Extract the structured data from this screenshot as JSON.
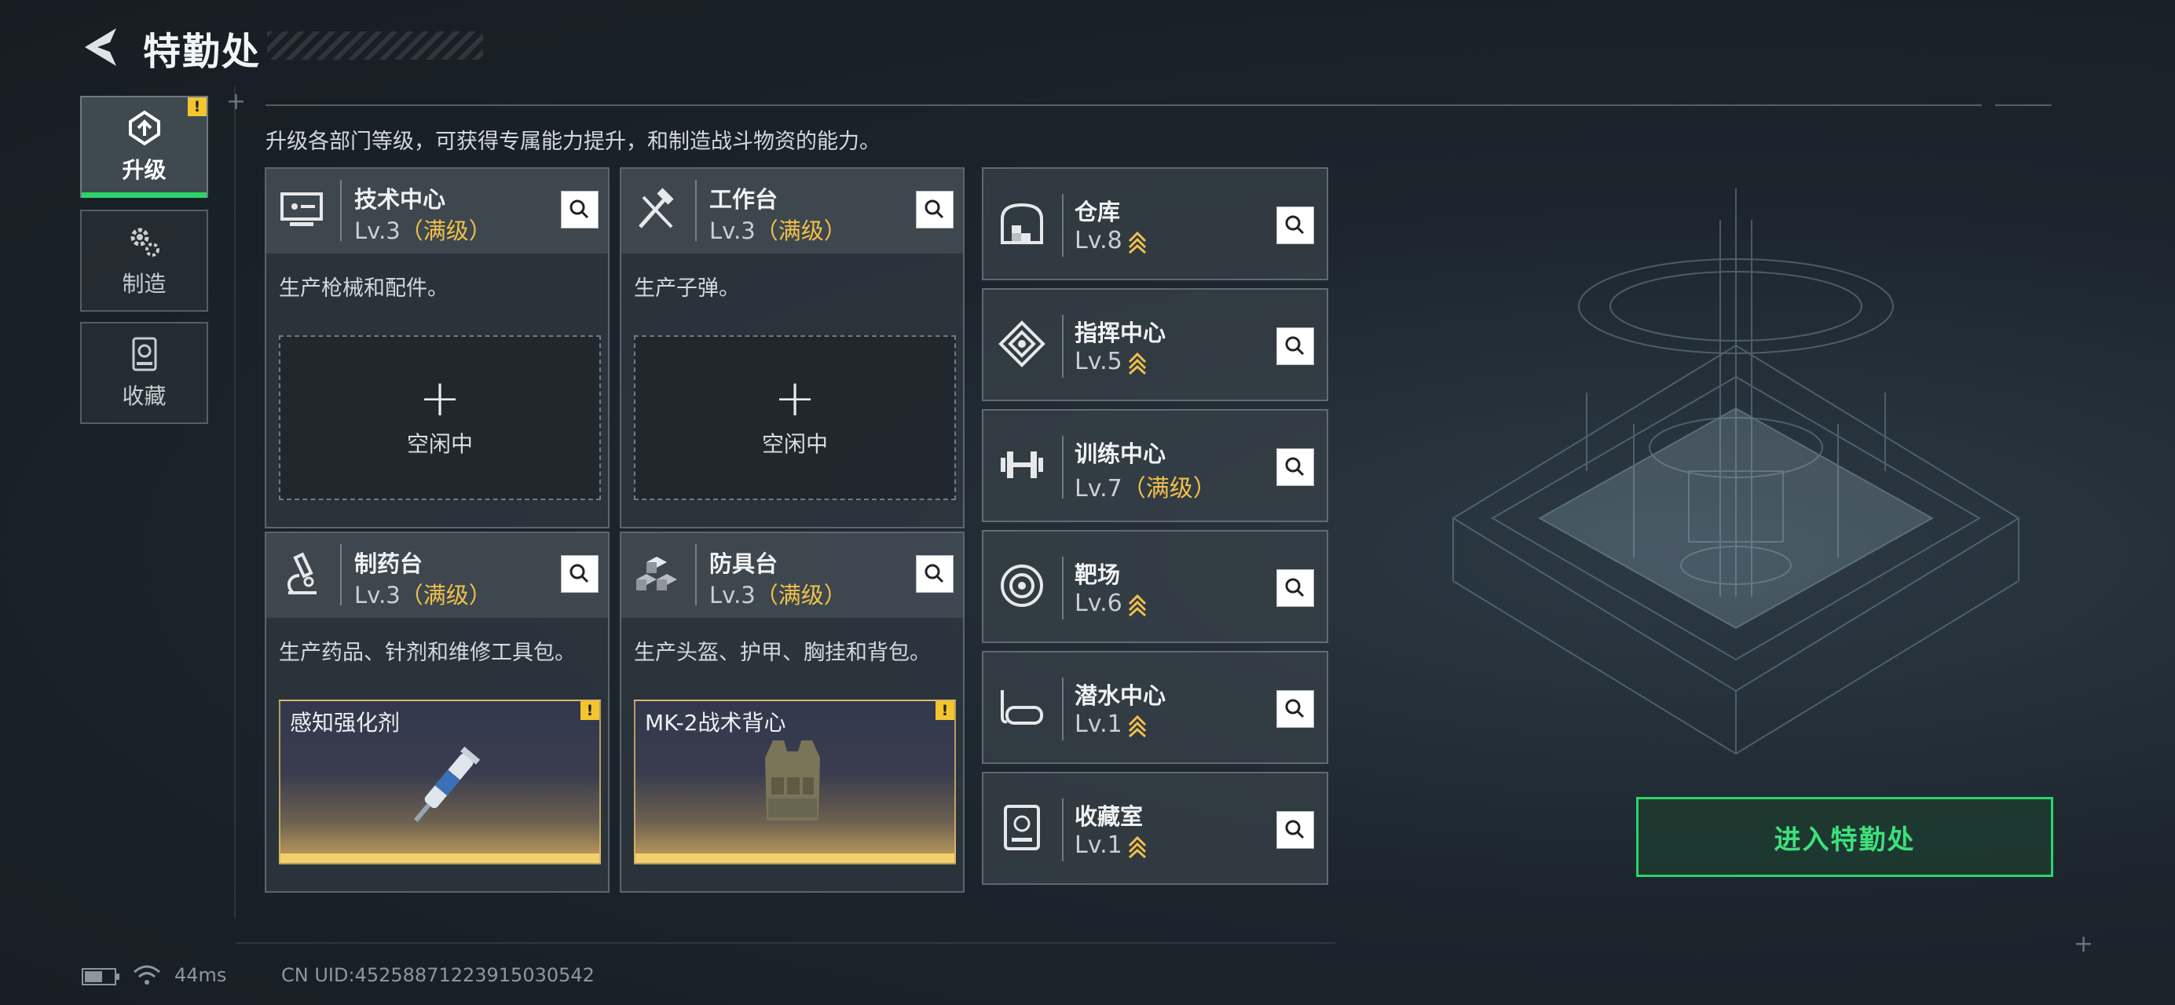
{
  "header": {
    "title": "特勤处"
  },
  "subtitle": "升级各部门等级，可获得专属能力提升，和制造战斗物资的能力。",
  "tabs": [
    {
      "label": "升级",
      "active": true,
      "alert": "!"
    },
    {
      "label": "制造",
      "active": false
    },
    {
      "label": "收藏",
      "active": false
    }
  ],
  "production": [
    {
      "name": "技术中心",
      "level": "Lv.3",
      "max_label": "（满级）",
      "icon": "monitor-icon",
      "desc": "生产枪械和配件。",
      "slot": {
        "type": "idle",
        "label": "空闲中"
      }
    },
    {
      "name": "工作台",
      "level": "Lv.3",
      "max_label": "（满级）",
      "icon": "tools-icon",
      "desc": "生产子弹。",
      "slot": {
        "type": "idle",
        "label": "空闲中"
      }
    },
    {
      "name": "制药台",
      "level": "Lv.3",
      "max_label": "（满级）",
      "icon": "microscope-icon",
      "desc": "生产药品、针剂和维修工具包。",
      "slot": {
        "type": "item",
        "label": "感知强化剂",
        "alert": "!"
      }
    },
    {
      "name": "防具台",
      "level": "Lv.3",
      "max_label": "（满级）",
      "icon": "armor-blocks-icon",
      "desc": "生产头盔、护甲、胸挂和背包。",
      "slot": {
        "type": "item",
        "label": "MK-2战术背心",
        "alert": "!"
      }
    }
  ],
  "facilities": [
    {
      "name": "仓库",
      "level": "Lv.8",
      "max_label": "",
      "upgradable": true,
      "icon": "warehouse-icon"
    },
    {
      "name": "指挥中心",
      "level": "Lv.5",
      "max_label": "",
      "upgradable": true,
      "icon": "command-icon"
    },
    {
      "name": "训练中心",
      "level": "Lv.7",
      "max_label": "（满级）",
      "upgradable": false,
      "icon": "dumbbell-icon"
    },
    {
      "name": "靶场",
      "level": "Lv.6",
      "max_label": "",
      "upgradable": true,
      "icon": "target-icon"
    },
    {
      "name": "潜水中心",
      "level": "Lv.1",
      "max_label": "",
      "upgradable": true,
      "icon": "diving-mask-icon"
    },
    {
      "name": "收藏室",
      "level": "Lv.1",
      "max_label": "",
      "upgradable": true,
      "icon": "collection-room-icon"
    }
  ],
  "enter_button": "进入特勤处",
  "status": {
    "ping": "44ms",
    "uid": "CN UID:452588712239150305​42"
  },
  "colors": {
    "accent": "#2bd46a",
    "max_level": "#f0c04a",
    "alert": "#f3c52f"
  }
}
